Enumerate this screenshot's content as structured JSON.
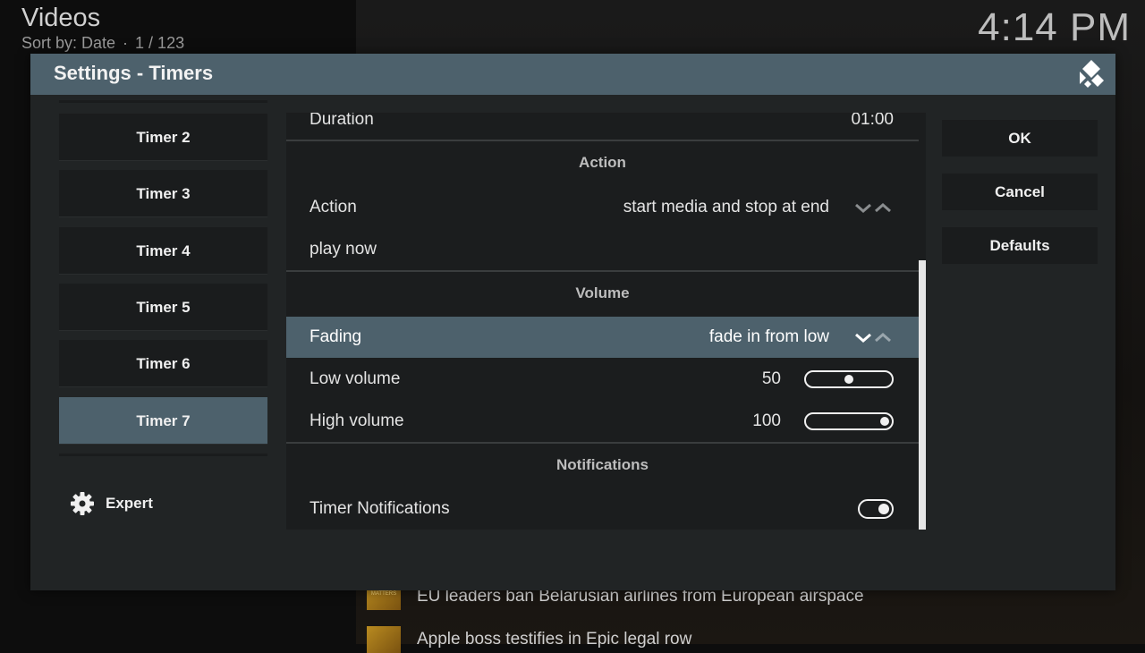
{
  "background": {
    "title": "Videos",
    "sort_label": "Sort by: Date",
    "separator": "·",
    "position": "1 / 123",
    "clock": "4:14 PM",
    "news": [
      {
        "title": "EU leaders ban Belarusian airlines from European airspace",
        "thumb_text": "BUSINESS MATTERS"
      },
      {
        "title": "Apple boss testifies in Epic legal row",
        "thumb_text": ""
      }
    ]
  },
  "dialog": {
    "title": "Settings - Timers",
    "logo_icon": "kodi-logo-icon",
    "timers": [
      {
        "label": "Timer 2",
        "active": false
      },
      {
        "label": "Timer 3",
        "active": false
      },
      {
        "label": "Timer 4",
        "active": false
      },
      {
        "label": "Timer 5",
        "active": false
      },
      {
        "label": "Timer 6",
        "active": false
      },
      {
        "label": "Timer 7",
        "active": true
      }
    ],
    "settings_level": {
      "label": "Expert",
      "icon": "gear-icon"
    },
    "settings": {
      "duration": {
        "label": "Duration",
        "value": "01:00"
      },
      "section_action": "Action",
      "action": {
        "label": "Action",
        "value": "start media and stop at end"
      },
      "play_now": {
        "label": "play now"
      },
      "section_volume": "Volume",
      "fading": {
        "label": "Fading",
        "value": "fade in from low"
      },
      "low_volume": {
        "label": "Low volume",
        "value": "50",
        "level": 0.5
      },
      "high_volume": {
        "label": "High volume",
        "value": "100",
        "level": 1.0
      },
      "section_notifications": "Notifications",
      "timer_notifications": {
        "label": "Timer Notifications",
        "enabled": true
      }
    },
    "buttons": {
      "ok": "OK",
      "cancel": "Cancel",
      "defaults": "Defaults"
    },
    "colors": {
      "accent": "#4d616c",
      "panel": "#1b1d1e",
      "dialog": "#212425"
    }
  }
}
